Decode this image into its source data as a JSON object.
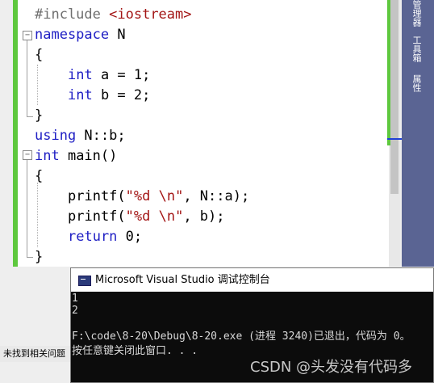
{
  "editor": {
    "lines": [
      {
        "text": "#include <iostream>"
      },
      {
        "text": "namespace N"
      },
      {
        "text": "{"
      },
      {
        "text": "int a = 1;"
      },
      {
        "text": "int b = 2;"
      },
      {
        "text": "}"
      },
      {
        "text": "using N::b;"
      },
      {
        "text": "int main()"
      },
      {
        "text": "{"
      },
      {
        "text": "printf(\"%d \\n\", N::a);"
      },
      {
        "text": "printf(\"%d \\n\", b);"
      },
      {
        "text": "return 0;"
      },
      {
        "text": "}"
      }
    ],
    "tokens": {
      "include_directive": "#include",
      "include_target": "<iostream>",
      "kw_namespace": "namespace",
      "ns_name": " N",
      "brace_open": "{",
      "brace_close": "}",
      "kw_int": "int",
      "decl_a": " a = 1;",
      "decl_b": " b = 2;",
      "kw_using": "using",
      "using_rest": " N::b;",
      "main_sig": " main()",
      "printf1_head": "printf(",
      "printf1_str": "\"%d \\n\"",
      "printf1_tail": ", N::a);",
      "printf2_head": "printf(",
      "printf2_str": "\"%d \\n\"",
      "printf2_tail": ", b);",
      "kw_return": "return",
      "return_rest": " 0;"
    },
    "fold_glyph": "−"
  },
  "dock": {
    "tabs": [
      "管理器",
      "工具箱",
      "属性"
    ]
  },
  "status": {
    "left_text": "未找到相关问题"
  },
  "console": {
    "title": "Microsoft Visual Studio 调试控制台",
    "output": [
      "1",
      "2",
      "",
      "F:\\code\\8-20\\Debug\\8-20.exe (进程 3240)已退出，代码为 0。",
      "按任意键关闭此窗口. . ."
    ]
  },
  "watermark": "CSDN @头发没有代码多",
  "colors": {
    "keyword": "#1f1fc4",
    "string": "#a31515",
    "change_bar": "#5ec83e",
    "dock": "#5a6493"
  }
}
